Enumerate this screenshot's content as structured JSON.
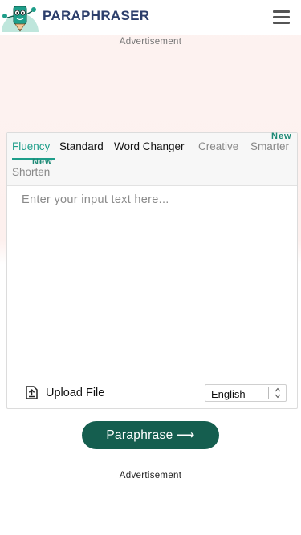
{
  "header": {
    "brand": "PARAPHRASER",
    "logo_icon": "pencil-mascot-icon",
    "menu_icon": "hamburger-menu-icon"
  },
  "ads": {
    "top_label": "Advertisement",
    "bottom_label": "Advertisement"
  },
  "tabs": [
    {
      "label": "Fluency",
      "active": true
    },
    {
      "label": "Standard",
      "active": false
    },
    {
      "label": "Word Changer",
      "active": false
    },
    {
      "label": "Creative",
      "active": false
    },
    {
      "label": "Smarter",
      "active": false,
      "badge": "New"
    },
    {
      "label": "Shorten",
      "active": false,
      "badge": "New"
    }
  ],
  "input": {
    "placeholder": "Enter your input text here...",
    "value": ""
  },
  "upload": {
    "label": "Upload File",
    "icon": "upload-file-icon"
  },
  "language": {
    "selected": "English"
  },
  "action": {
    "label": "Paraphrase ⟶"
  },
  "colors": {
    "accent": "#1e9e8a",
    "button": "#155e4f",
    "brand_text": "#2c3e6b",
    "badge": "#1e8a76"
  }
}
